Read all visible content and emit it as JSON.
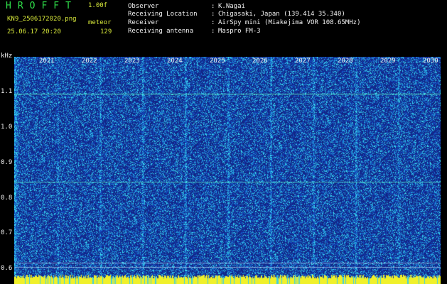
{
  "header": {
    "app_title": "HROFFT",
    "version": "1.00f",
    "file_name": "KN9_2506172020.png",
    "timestamp": "25.06.17 20:20",
    "meteor_label": "meteor",
    "meteor_count": "129",
    "info": [
      {
        "label": "Observer",
        "value": "K.Nagai"
      },
      {
        "label": "Receiving Location",
        "value": "Chigasaki, Japan (139.414 35.340)"
      },
      {
        "label": "Receiver",
        "value": "AirSpy mini (Miakejima VOR 108.65MHz)"
      },
      {
        "label": "Receiving antenna",
        "value": "Maspro FM-3"
      }
    ]
  },
  "waterfall": {
    "y_unit": "kHz",
    "y_ticks": [
      "1.1",
      "1.0",
      "0.9",
      "0.8",
      "0.7",
      "0.6"
    ],
    "x_labels": [
      "2021",
      "2022",
      "2023",
      "2024",
      "2025",
      "2026",
      "2027",
      "2028",
      "2029",
      "2030"
    ],
    "colors": {
      "background": "#000000",
      "noise_low": "#1a2b8c",
      "noise_high": "#27c7e6",
      "carrier": "#35e0c8",
      "header_green": "#2fe04a",
      "header_yellow": "#d8e93a",
      "text_white": "#f2f2f2",
      "bottom_bar": "#f0f02a"
    }
  }
}
